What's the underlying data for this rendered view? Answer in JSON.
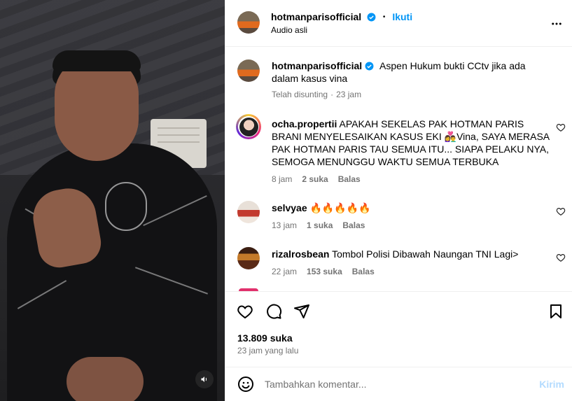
{
  "header": {
    "username": "hotmanparisofficial",
    "separator": "•",
    "follow_label": "Ikuti",
    "audio_label": "Audio asli",
    "more_icon": "more-horizontal-icon"
  },
  "caption": {
    "username": "hotmanparisofficial",
    "text": "Aspen Hukum bukti CCtv jika ada dalam kasus vina",
    "edited_label": "Telah disunting",
    "dot": "·",
    "time": "23 jam"
  },
  "comments": [
    {
      "username": "ocha.propertii",
      "text": "APAKAH SEKELAS PAK HOTMAN PARIS BRANI MENYELESAIKAN KASUS EKI 👩‍❤️‍👨Vina, SAYA MERASA PAK HOTMAN PARIS TAU SEMUA ITU... SIAPA PELAKU NYA, SEMOGA MENUNGGU WAKTU SEMUA TERBUKA",
      "time": "8 jam",
      "likes": "2 suka",
      "reply": "Balas"
    },
    {
      "username": "selvyae",
      "text": "🔥🔥🔥🔥🔥",
      "time": "13 jam",
      "likes": "1 suka",
      "reply": "Balas"
    },
    {
      "username": "rizalrosbean",
      "text": "Tombol Polisi Dibawah Naungan TNI Lagi>",
      "time": "22 jam",
      "likes": "153 suka",
      "reply": "Balas"
    }
  ],
  "actions": {
    "likes": "13.809 suka",
    "posted_time": "23 jam yang lalu"
  },
  "add_comment": {
    "placeholder": "Tambahkan komentar...",
    "post_label": "Kirim"
  },
  "colors": {
    "accent": "#0095f6",
    "verified": "#0095f6",
    "muted_text": "#737373",
    "post_disabled": "#b3dbff"
  }
}
